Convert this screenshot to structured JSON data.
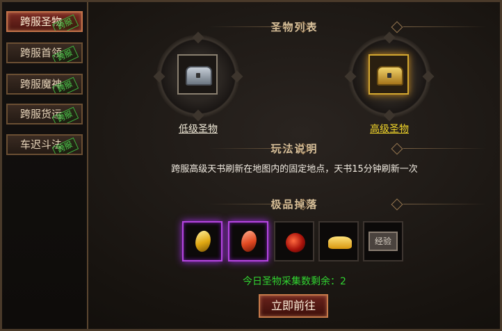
{
  "sidebar": {
    "tabs": [
      {
        "label": "跨服圣物",
        "stamp": "跨服",
        "active": true
      },
      {
        "label": "跨服首领",
        "stamp": "跨服",
        "active": false
      },
      {
        "label": "跨服魔神",
        "stamp": "跨服",
        "active": false
      },
      {
        "label": "跨服货运",
        "stamp": "跨服",
        "active": false
      },
      {
        "label": "车迟斗法",
        "stamp": "跨服",
        "active": false
      }
    ]
  },
  "relics": {
    "title": "圣物列表",
    "low": {
      "label": "低级圣物",
      "label_color": "#f1ead8",
      "icon": "silver-chest-icon"
    },
    "high": {
      "label": "高级圣物",
      "label_color": "#f2d62a",
      "icon": "gold-chest-icon"
    }
  },
  "rules": {
    "title": "玩法说明",
    "text": "跨服高级天书刷新在地图内的固定地点，天书15分钟刷新一次"
  },
  "drops": {
    "title": "极品掉落",
    "items": [
      {
        "icon": "yellow-gem-icon",
        "quality": "purple"
      },
      {
        "icon": "red-gem-icon",
        "quality": "purple"
      },
      {
        "icon": "red-orb-icon",
        "quality": "normal"
      },
      {
        "icon": "gold-ingot-icon",
        "quality": "normal"
      },
      {
        "icon": "experience-scroll-icon",
        "quality": "normal",
        "text": "经验"
      }
    ]
  },
  "status": {
    "remaining_label": "今日圣物采集数剩余：2"
  },
  "actions": {
    "go_label": "立即前往"
  },
  "colors": {
    "accent_green": "#31d431",
    "highlight_yellow": "#f2d62a",
    "purple_quality": "#b545e0"
  }
}
